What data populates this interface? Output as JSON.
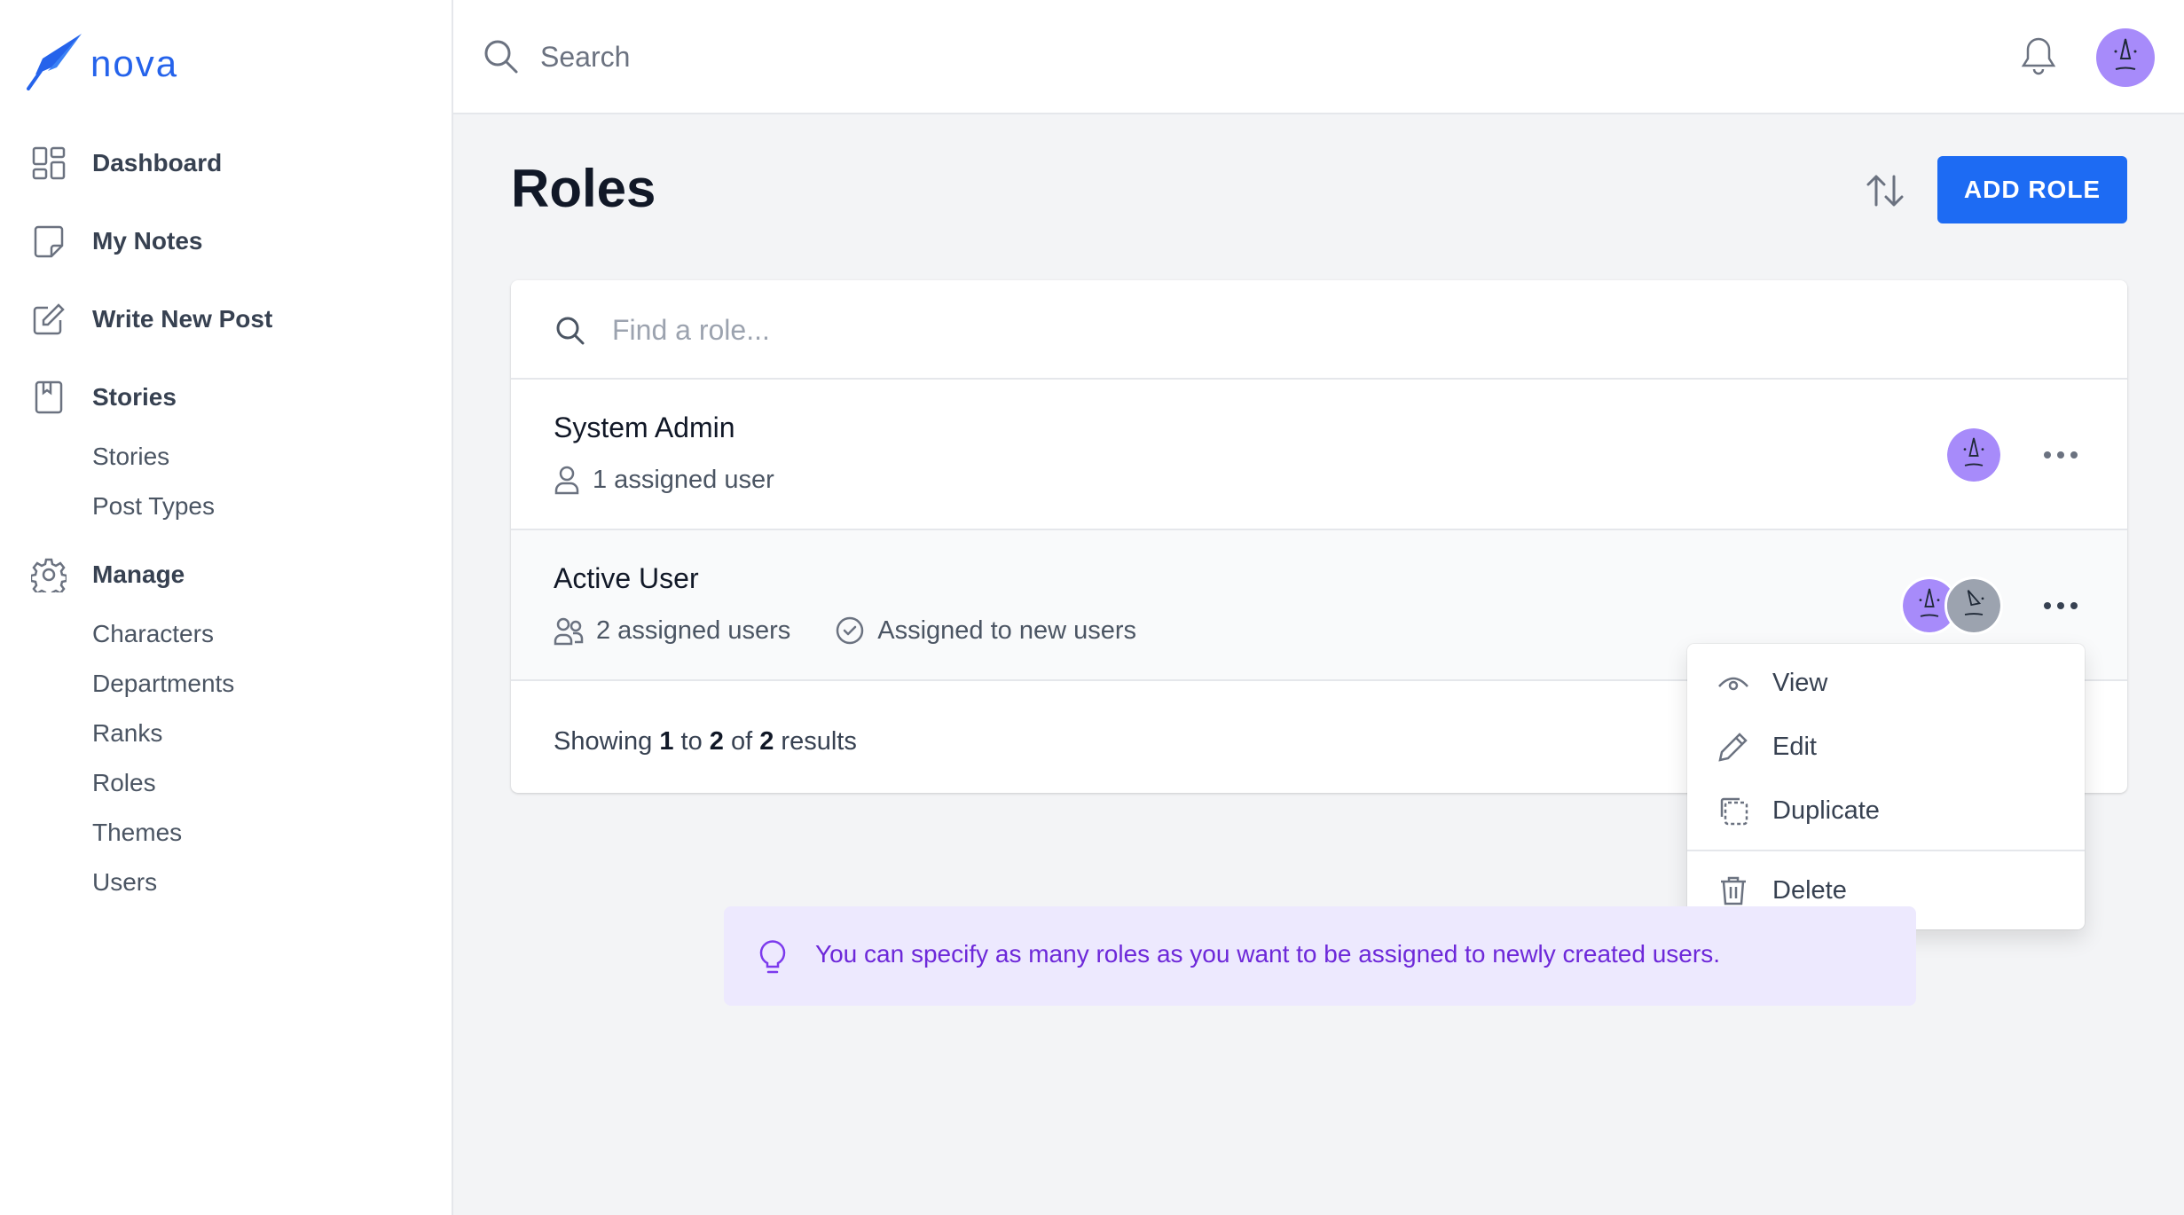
{
  "app": {
    "logo_text": "nova"
  },
  "colors": {
    "accent": "#1d6bf3",
    "tip_bg": "#ede9fe",
    "tip_text": "#6d28d9",
    "avatar_purple": "#a78bfa",
    "avatar_gray": "#9ca3af"
  },
  "sidebar": {
    "items": [
      {
        "label": "Dashboard",
        "icon": "dashboard-icon"
      },
      {
        "label": "My Notes",
        "icon": "note-icon"
      },
      {
        "label": "Write New Post",
        "icon": "edit-icon"
      },
      {
        "label": "Stories",
        "icon": "book-icon",
        "children": [
          "Stories",
          "Post Types"
        ]
      },
      {
        "label": "Manage",
        "icon": "gear-icon",
        "children": [
          "Characters",
          "Departments",
          "Ranks",
          "Roles",
          "Themes",
          "Users"
        ]
      }
    ]
  },
  "topbar": {
    "search_placeholder": "Search"
  },
  "page": {
    "title": "Roles",
    "add_button": "ADD ROLE"
  },
  "roles": {
    "search_placeholder": "Find a role...",
    "items": [
      {
        "name": "System Admin",
        "assigned": "1 assigned user"
      },
      {
        "name": "Active User",
        "assigned": "2 assigned users",
        "default_note": "Assigned to new users"
      }
    ],
    "results": {
      "prefix": "Showing",
      "from": "1",
      "to_word": "to",
      "to": "2",
      "of_word": "of",
      "total": "2",
      "suffix": "results"
    }
  },
  "menu": {
    "items": [
      "View",
      "Edit",
      "Duplicate",
      "Delete"
    ]
  },
  "tip": {
    "text": "You can specify as many roles as you want to be assigned to newly created users."
  }
}
